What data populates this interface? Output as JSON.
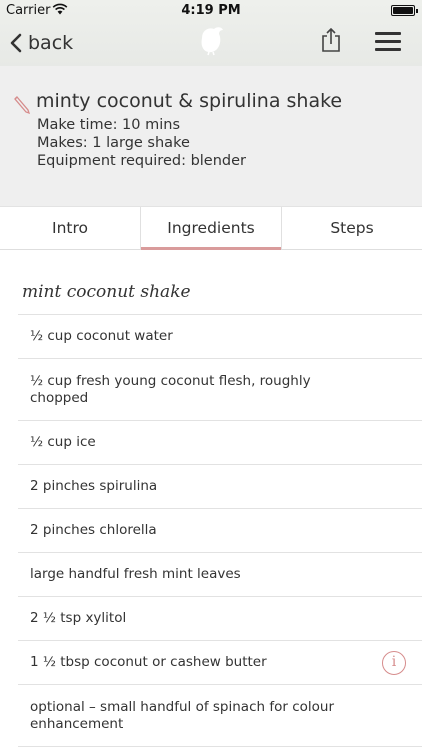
{
  "status_bar": {
    "carrier": "Carrier",
    "time": "4:19 PM",
    "battery_level": 1.0
  },
  "nav": {
    "back_label": "back",
    "logo_icon": "bird-icon",
    "share_icon": "share-icon",
    "menu_icon": "hamburger-menu-icon"
  },
  "recipe": {
    "title": "minty coconut & spirulina shake",
    "make_time": "Make time: 10 mins",
    "makes": "Makes: 1 large shake",
    "equipment": "Equipment required: blender"
  },
  "tabs": [
    {
      "label": "Intro",
      "active": false
    },
    {
      "label": "Ingredients",
      "active": true
    },
    {
      "label": "Steps",
      "active": false
    }
  ],
  "section_title": "mint coconut shake",
  "ingredients": [
    {
      "text": "½ cup coconut water"
    },
    {
      "text": "½ cup fresh young coconut flesh, roughly chopped"
    },
    {
      "text": "½ cup ice"
    },
    {
      "text": "2 pinches spirulina"
    },
    {
      "text": "2 pinches chlorella"
    },
    {
      "text": "large handful fresh mint leaves"
    },
    {
      "text": "2 ½ tsp xylitol"
    },
    {
      "text": "1 ½ tbsp coconut or cashew butter",
      "info_icon": "i"
    },
    {
      "text": "optional – small handful of spinach for colour enhancement"
    }
  ],
  "colors": {
    "accent": "#d99b9b",
    "header_bg": "#efefef",
    "nav_bg": "#e9ebe8"
  }
}
